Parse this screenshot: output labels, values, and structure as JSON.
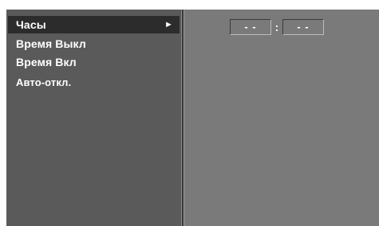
{
  "menu": {
    "items": [
      {
        "label": "Часы",
        "selected": true,
        "arrow": "►"
      },
      {
        "label": "Время Выкл",
        "selected": false
      },
      {
        "label": "Время Вкл",
        "selected": false
      },
      {
        "label": "Авто-откл.",
        "selected": false
      }
    ]
  },
  "clock": {
    "hours": "- -",
    "separator": ":",
    "minutes": "- -"
  },
  "colors": {
    "selected_bg": "#2c2c2c",
    "menu_bg": "#5a5a5a",
    "content_bg": "#7a7a7a",
    "text": "#ffffff"
  }
}
